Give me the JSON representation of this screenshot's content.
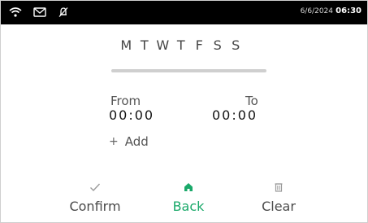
{
  "status": {
    "date": "6/6/2024",
    "time": "06:30",
    "icons": [
      "wifi-icon",
      "mail-icon",
      "bell-off-icon"
    ]
  },
  "days": {
    "letters": [
      "M",
      "T",
      "W",
      "T",
      "F",
      "S",
      "S"
    ]
  },
  "schedule": {
    "from_label": "From",
    "from_time": "00:00",
    "to_label": "To",
    "to_time": "00:00",
    "add_label": "Add",
    "add_symbol": "+"
  },
  "bottom_nav": {
    "confirm_label": "Confirm",
    "back_label": "Back",
    "clear_label": "Clear",
    "active_color": "#1aa96a"
  }
}
